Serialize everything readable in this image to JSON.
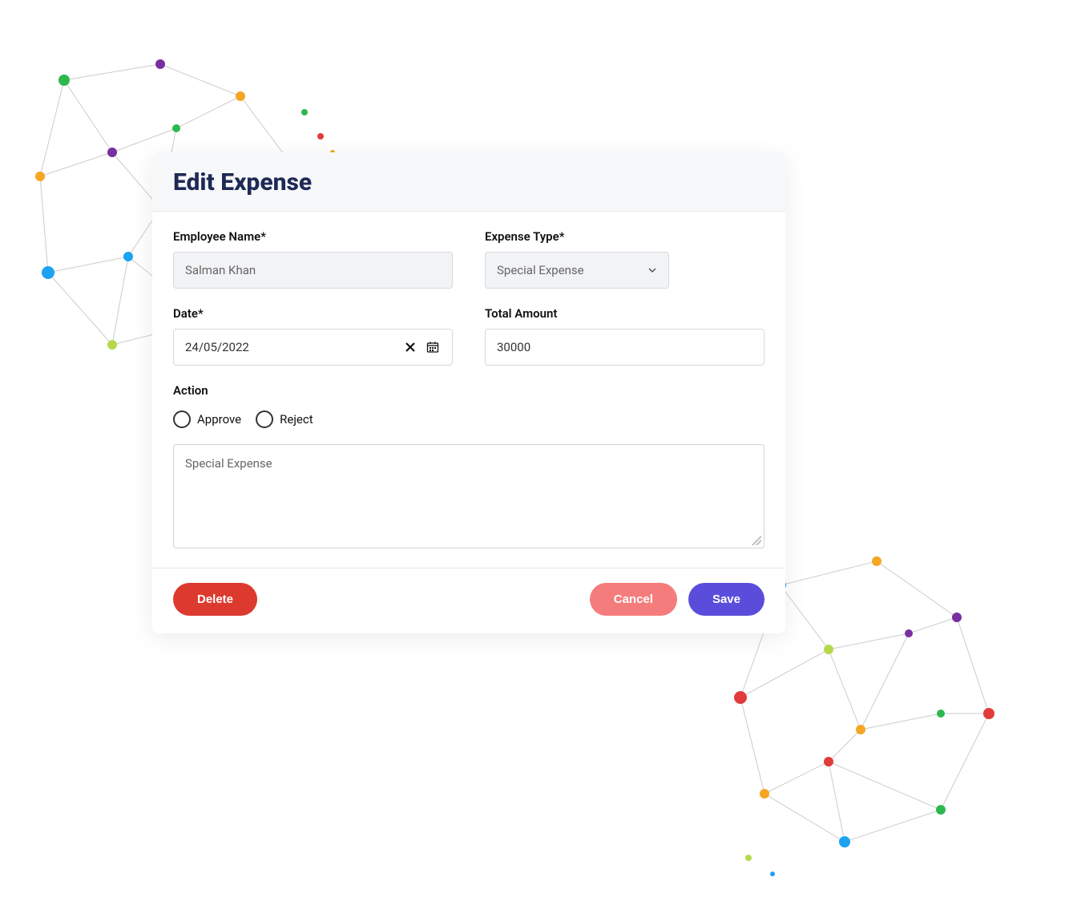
{
  "modal": {
    "title": "Edit Expense",
    "fields": {
      "employee_name": {
        "label": "Employee Name*",
        "value": "Salman Khan"
      },
      "expense_type": {
        "label": "Expense Type*",
        "value": "Special Expense"
      },
      "date": {
        "label": "Date*",
        "value": "24/05/2022"
      },
      "total_amount": {
        "label": "Total Amount",
        "value": "30000"
      },
      "action": {
        "label": "Action",
        "options": {
          "approve": "Approve",
          "reject": "Reject"
        }
      },
      "notes": {
        "value": "Special Expense"
      }
    },
    "buttons": {
      "delete": "Delete",
      "cancel": "Cancel",
      "save": "Save"
    }
  },
  "colors": {
    "title": "#1e2a55",
    "delete": "#dc3a2f",
    "cancel": "#f47c7c",
    "save": "#5b4ddb"
  }
}
